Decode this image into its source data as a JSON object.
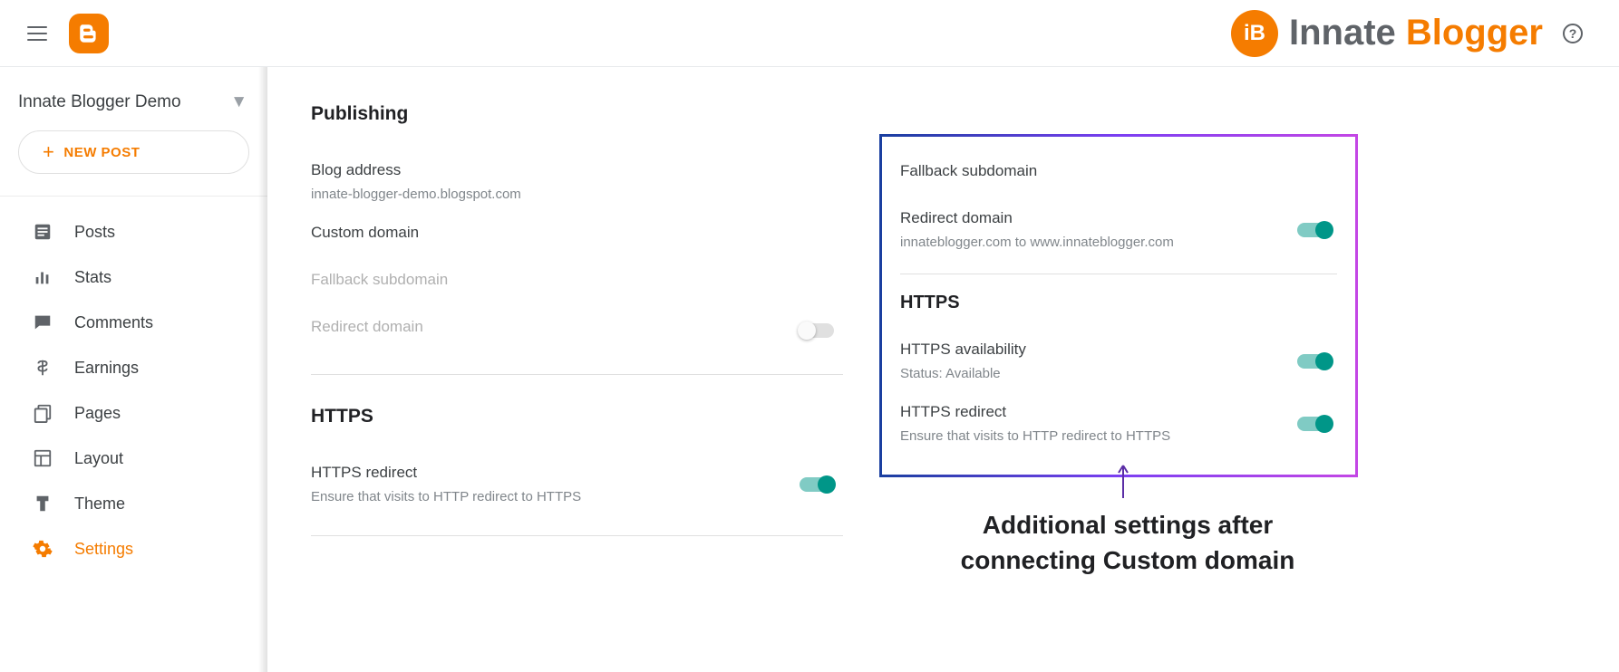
{
  "header": {
    "brand_part1": "Innate ",
    "brand_part2": "Blogger",
    "ib_badge": "iB"
  },
  "sidebar": {
    "blog_name": "Innate Blogger Demo",
    "new_post": "NEW POST",
    "items": [
      {
        "label": "Posts"
      },
      {
        "label": "Stats"
      },
      {
        "label": "Comments"
      },
      {
        "label": "Earnings"
      },
      {
        "label": "Pages"
      },
      {
        "label": "Layout"
      },
      {
        "label": "Theme"
      },
      {
        "label": "Settings"
      }
    ]
  },
  "main": {
    "publishing": {
      "title": "Publishing",
      "blog_address_label": "Blog address",
      "blog_address_value": "innate-blogger-demo.blogspot.com",
      "custom_domain_label": "Custom domain",
      "fallback_subdomain_label": "Fallback subdomain",
      "redirect_domain_label": "Redirect domain"
    },
    "https": {
      "title": "HTTPS",
      "redirect_label": "HTTPS redirect",
      "redirect_sub": "Ensure that visits to HTTP redirect to HTTPS"
    }
  },
  "callout": {
    "fallback_label": "Fallback subdomain",
    "redirect_label": "Redirect domain",
    "redirect_sub": "innateblogger.com to www.innateblogger.com",
    "https_title": "HTTPS",
    "avail_label": "HTTPS availability",
    "avail_sub": "Status: Available",
    "https_redirect_label": "HTTPS redirect",
    "https_redirect_sub": "Ensure that visits to HTTP redirect to HTTPS"
  },
  "annotation": "Additional settings after connecting Custom domain"
}
